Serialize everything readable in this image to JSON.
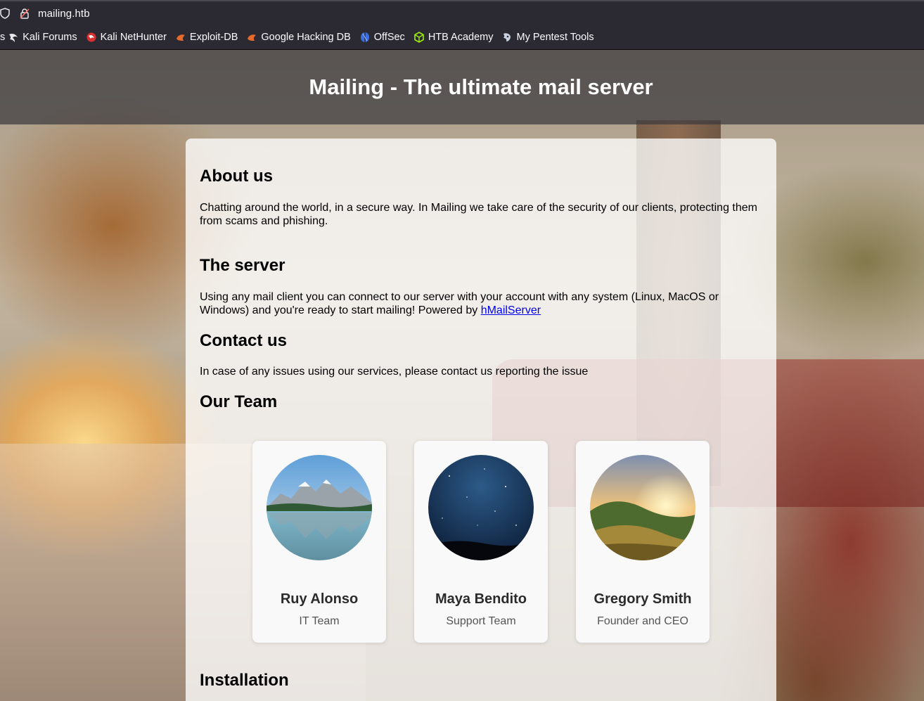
{
  "browser": {
    "url": "mailing.htb",
    "bookmarks": [
      {
        "label": "s",
        "icon": "kali-icon"
      },
      {
        "label": "Kali Forums",
        "icon": "kali-dragon-icon"
      },
      {
        "label": "Kali NetHunter",
        "icon": "nethunter-icon"
      },
      {
        "label": "Exploit-DB",
        "icon": "exploitdb-icon"
      },
      {
        "label": "Google Hacking DB",
        "icon": "ghdb-icon"
      },
      {
        "label": "OffSec",
        "icon": "offsec-icon"
      },
      {
        "label": "HTB Academy",
        "icon": "htb-cube-icon"
      },
      {
        "label": "My Pentest Tools",
        "icon": "pentest-tools-icon"
      }
    ]
  },
  "header": {
    "title": "Mailing - The ultimate mail server"
  },
  "about": {
    "heading": "About us",
    "text": "Chatting around the world, in a secure way. In Mailing we take care of the security of our clients, protecting them from scams and phishing."
  },
  "server": {
    "heading": "The server",
    "text": "Using any mail client you can connect to our server with your account with any system (Linux, MacOS or Windows) and you're ready to start mailing! Powered by",
    "link": "hMailServer"
  },
  "contact": {
    "heading": "Contact us",
    "text": "In case of any issues using our services, please contact us reporting the issue"
  },
  "team": {
    "heading": "Our Team",
    "members": [
      {
        "name": "Ruy Alonso",
        "role": "IT Team",
        "photo": "mountain-lake-photo"
      },
      {
        "name": "Maya Bendito",
        "role": "Support Team",
        "photo": "night-sky-photo"
      },
      {
        "name": "Gregory Smith",
        "role": "Founder and CEO",
        "photo": "sunset-hills-photo"
      }
    ]
  },
  "installation": {
    "heading": "Installation"
  },
  "colors": {
    "browser_chrome": "#2b2a33",
    "link": "#0000ee",
    "header_overlay": "#3c3a3e"
  }
}
